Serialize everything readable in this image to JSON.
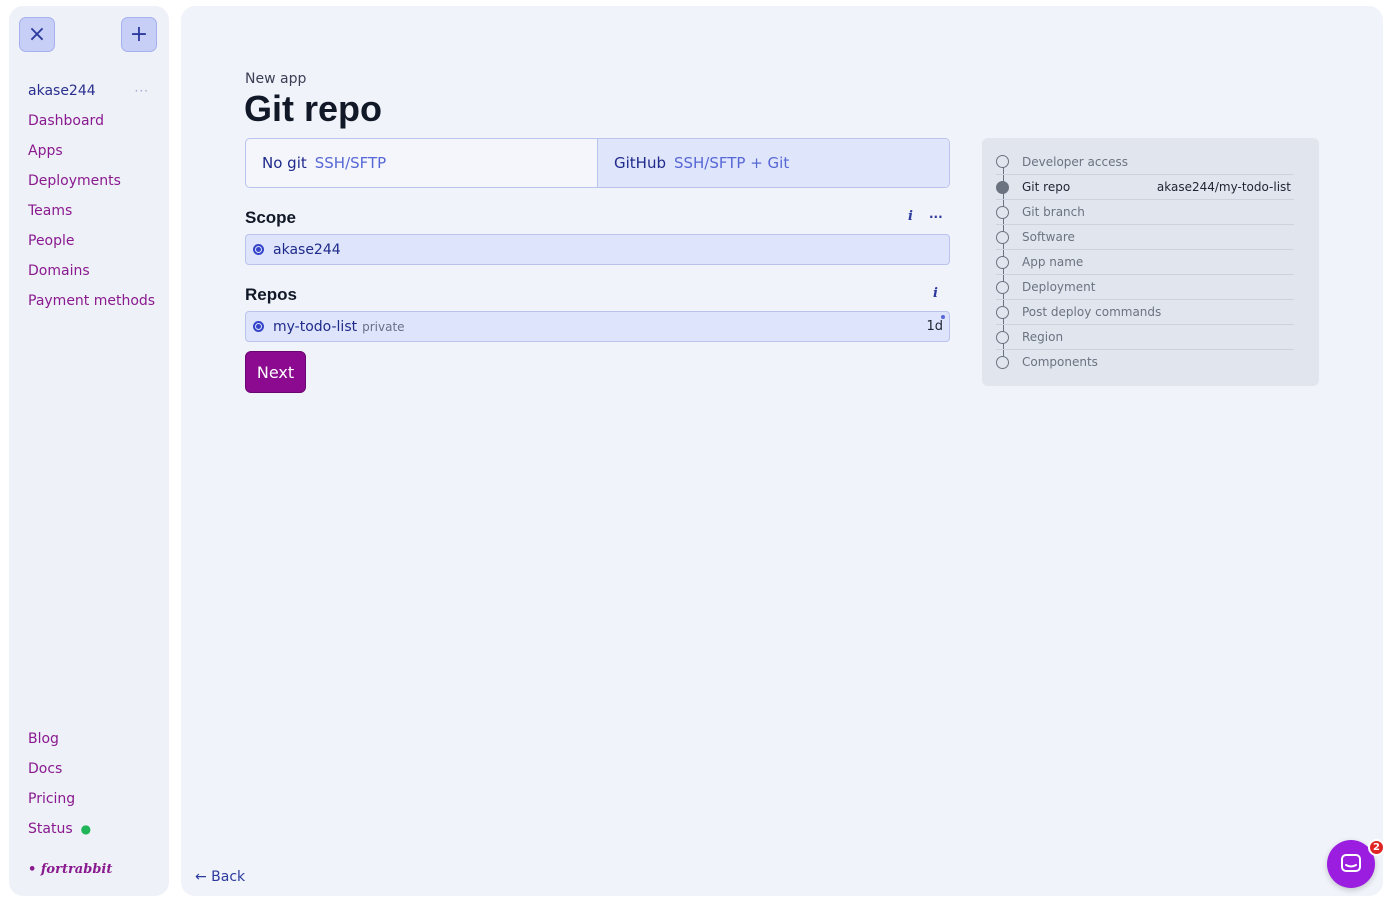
{
  "sidebar": {
    "close_icon": "×",
    "add_icon": "+",
    "user": "akase244",
    "user_menu": "···",
    "nav": [
      "Dashboard",
      "Apps",
      "Deployments",
      "Teams",
      "People",
      "Domains",
      "Payment methods"
    ],
    "bottom": [
      "Blog",
      "Docs",
      "Pricing",
      "Status"
    ],
    "status_dot": "●",
    "status_color": "#21b55a",
    "logo": "• fortrabbit"
  },
  "main": {
    "breadcrumb": "New app",
    "title": "Git repo",
    "tabs": [
      {
        "label": "No git",
        "sub": "SSH/SFTP",
        "active": false
      },
      {
        "label": "GitHub",
        "sub": "SSH/SFTP + Git",
        "active": true
      }
    ],
    "scope": {
      "heading": "Scope",
      "info_icon": "i",
      "more_icon": "···",
      "option": "akase244"
    },
    "repos": {
      "heading": "Repos",
      "info_icon": "i",
      "option": {
        "name": "my-todo-list",
        "visibility": "private",
        "age": "1d"
      }
    },
    "next_label": "Next",
    "back_label": "← Back"
  },
  "steps": [
    {
      "label": "Developer access",
      "value": "",
      "done": false
    },
    {
      "label": "Git repo",
      "value": "akase244/my-todo-list",
      "done": true
    },
    {
      "label": "Git branch",
      "value": "",
      "done": false
    },
    {
      "label": "Software",
      "value": "",
      "done": false
    },
    {
      "label": "App name",
      "value": "",
      "done": false
    },
    {
      "label": "Deployment",
      "value": "",
      "done": false
    },
    {
      "label": "Post deploy commands",
      "value": "",
      "done": false
    },
    {
      "label": "Region",
      "value": "",
      "done": false
    },
    {
      "label": "Components",
      "value": "",
      "done": false
    }
  ],
  "chat": {
    "icon": "chat-bubble-icon",
    "badge": "2"
  },
  "colors": {
    "accent": "#8b0a8f",
    "link": "#2c3a9e",
    "chat": "#9b1de0",
    "badge": "#e02424"
  }
}
